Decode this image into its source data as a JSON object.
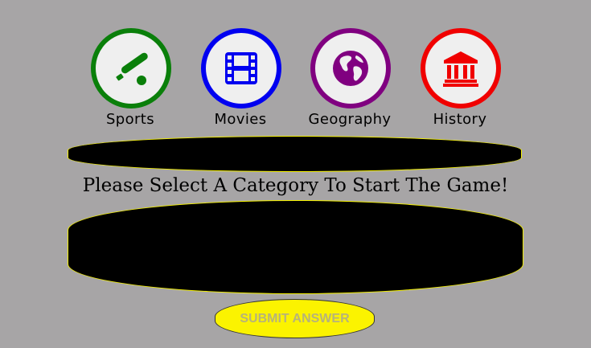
{
  "categories": [
    {
      "label": "Sports",
      "icon": "baseball-icon",
      "color": "#0a7f0a"
    },
    {
      "label": "Movies",
      "icon": "film-icon",
      "color": "#0000f0"
    },
    {
      "label": "Geography",
      "icon": "globe-icon",
      "color": "#800080"
    },
    {
      "label": "History",
      "icon": "landmark-icon",
      "color": "#f00000"
    }
  ],
  "question": {
    "text": ""
  },
  "prompt": "Please Select A Category To Start The Game!",
  "answer": {
    "value": ""
  },
  "submit": {
    "label": "SUBMIT ANSWER"
  },
  "colors": {
    "background": "#a7a5a6",
    "box_fill": "#000000",
    "box_border": "#f4f000",
    "button_fill": "#fbf300",
    "button_text": "#b7b37a"
  }
}
